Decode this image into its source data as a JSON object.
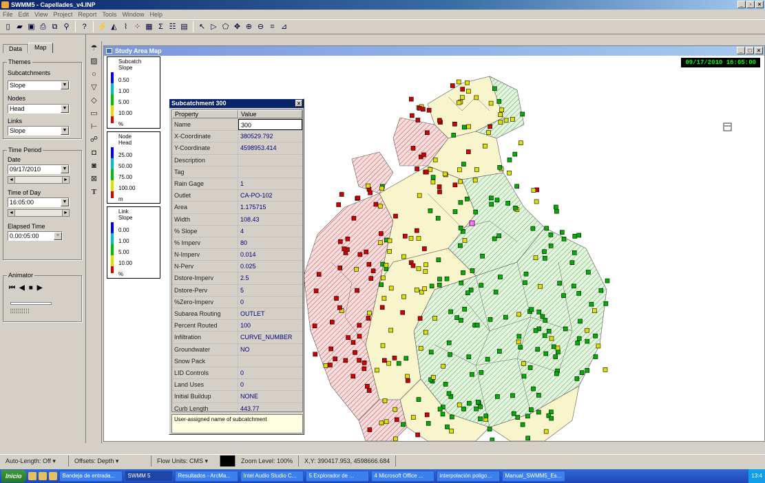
{
  "app": {
    "title": "SWMM5 - Capellades_v4.INP"
  },
  "menu": [
    "File",
    "Edit",
    "View",
    "Project",
    "Report",
    "Tools",
    "Window",
    "Help"
  ],
  "toolbar": [
    "new-icon",
    "open-icon",
    "save-icon",
    "print-icon",
    "copy-icon",
    "find-icon",
    "query-icon",
    "run-icon",
    "profile-icon",
    "timeseries-icon",
    "scatter-icon",
    "table-icon",
    "statistics-icon",
    "options-icon",
    "arrange-icon",
    "select-icon",
    "vertex-icon",
    "region-icon",
    "pan-icon",
    "zoom-in-icon",
    "zoom-out-icon",
    "full-extent-icon",
    "measure-icon"
  ],
  "left_panel": {
    "tabs": [
      "Data",
      "Map"
    ],
    "themes": {
      "label": "Themes",
      "subcatchments_label": "Subcatchments",
      "subcatchments_value": "Slope",
      "nodes_label": "Nodes",
      "nodes_value": "Head",
      "links_label": "Links",
      "links_value": "Slope"
    },
    "time_period": {
      "label": "Time Period",
      "date_label": "Date",
      "date_value": "09/17/2010",
      "time_label": "Time of Day",
      "time_value": "16:05:00",
      "elapsed_label": "Elapsed Time",
      "elapsed_value": "0.00:05:00"
    },
    "animator": {
      "label": "Animator"
    }
  },
  "map": {
    "title": "Study Area Map",
    "clock": "09/17/2010 16:05:00",
    "legend_subcatch": {
      "title1": "Subcatch",
      "title2": "Slope",
      "values": [
        "0.50",
        "1.00",
        "5.00",
        "10.00"
      ],
      "unit": "%",
      "colors": [
        "#0000ff",
        "#00c0c0",
        "#00c000",
        "#e0e000",
        "#e00000"
      ]
    },
    "legend_node": {
      "title1": "Node",
      "title2": "Head",
      "values": [
        "25.00",
        "50.00",
        "75.00",
        "100.00"
      ],
      "unit": "m"
    },
    "legend_link": {
      "title1": "Link",
      "title2": "Slope",
      "values": [
        "0.00",
        "1.00",
        "5.00",
        "10.00"
      ],
      "unit": "%"
    }
  },
  "property_editor": {
    "title": "Subcatchment 300",
    "header": {
      "property": "Property",
      "value": "Value"
    },
    "rows": [
      {
        "p": "Name",
        "v": "300"
      },
      {
        "p": "X-Coordinate",
        "v": "380529.792"
      },
      {
        "p": "Y-Coordinate",
        "v": "4598953.414"
      },
      {
        "p": "Description",
        "v": ""
      },
      {
        "p": "Tag",
        "v": ""
      },
      {
        "p": "Rain Gage",
        "v": "1"
      },
      {
        "p": "Outlet",
        "v": "CA-PO-102"
      },
      {
        "p": "Area",
        "v": "1.175715"
      },
      {
        "p": "Width",
        "v": "108.43"
      },
      {
        "p": "% Slope",
        "v": "4"
      },
      {
        "p": "% Imperv",
        "v": "80"
      },
      {
        "p": "N-Imperv",
        "v": "0.014"
      },
      {
        "p": "N-Perv",
        "v": "0.025"
      },
      {
        "p": "Dstore-Imperv",
        "v": "2.5"
      },
      {
        "p": "Dstore-Perv",
        "v": "5"
      },
      {
        "p": "%Zero-Imperv",
        "v": "0"
      },
      {
        "p": "Subarea Routing",
        "v": "OUTLET"
      },
      {
        "p": "Percent Routed",
        "v": "100"
      },
      {
        "p": "Infiltration",
        "v": "CURVE_NUMBER"
      },
      {
        "p": "Groundwater",
        "v": "NO"
      },
      {
        "p": "Snow Pack",
        "v": ""
      },
      {
        "p": "LID Controls",
        "v": "0"
      },
      {
        "p": "Land Uses",
        "v": "0"
      },
      {
        "p": "Initial Buildup",
        "v": "NONE"
      },
      {
        "p": "Curb Length",
        "v": "443.77"
      }
    ],
    "description": "User-assigned name of subcatchment"
  },
  "status": {
    "auto_length": "Auto-Length: Off",
    "offsets": "Offsets: Depth",
    "flow_units": "Flow Units: CMS",
    "zoom": "Zoom Level: 100%",
    "xy": "X,Y: 390417.953, 4598666.684"
  },
  "taskbar": {
    "start": "Inicio",
    "tasks": [
      "Bandeja de entrada...",
      "SWMM 5",
      "Resultados - ArcMa...",
      "Intel Audio Studio C...",
      "5 Explorador de ...",
      "4 Microsoft Office ...",
      "interpolación poligo...",
      "Manual_SWMM5_Es..."
    ],
    "clock": "13:4"
  }
}
